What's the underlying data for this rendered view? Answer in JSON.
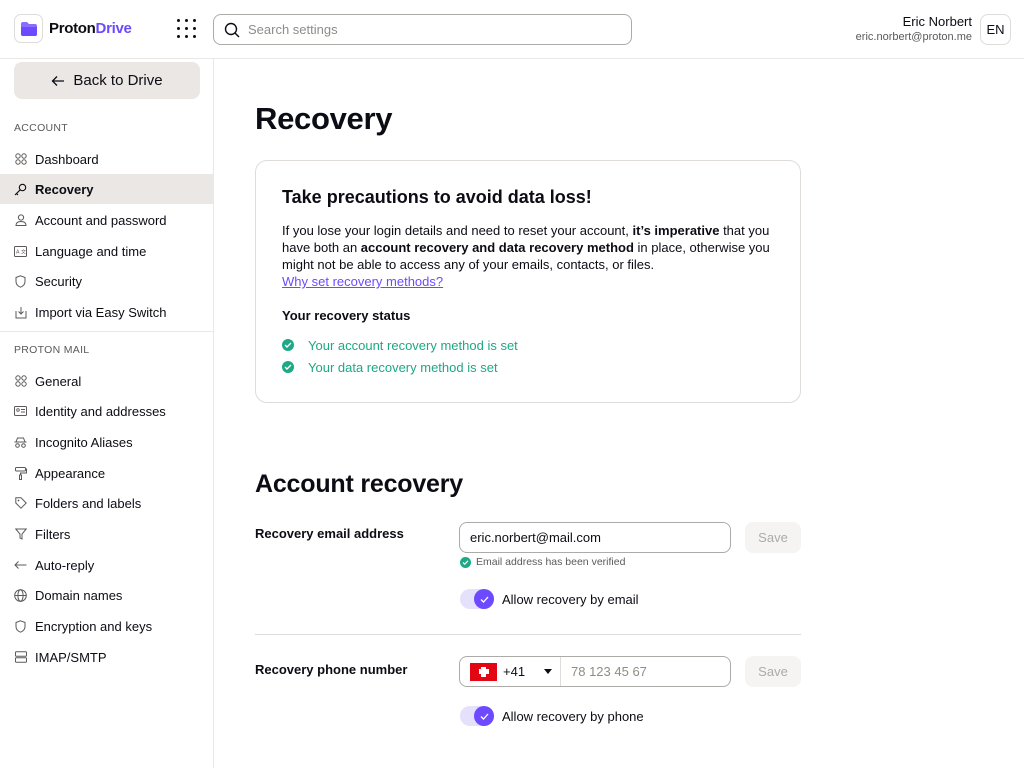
{
  "header": {
    "brand_first": "Proton",
    "brand_second": "Drive",
    "search_placeholder": "Search settings",
    "user_name": "Eric Norbert",
    "user_email": "eric.norbert@proton.me",
    "language": "EN"
  },
  "sidebar": {
    "back_label": "Back to Drive",
    "account_title": "ACCOUNT",
    "account_items": [
      {
        "label": "Dashboard",
        "icon": "grid-icon"
      },
      {
        "label": "Recovery",
        "icon": "key-icon",
        "active": true
      },
      {
        "label": "Account and password",
        "icon": "user-icon"
      },
      {
        "label": "Language and time",
        "icon": "language-icon"
      },
      {
        "label": "Security",
        "icon": "shield-icon"
      },
      {
        "label": "Import via Easy Switch",
        "icon": "import-icon"
      }
    ],
    "mail_title": "PROTON MAIL",
    "mail_items": [
      {
        "label": "General",
        "icon": "grid-icon"
      },
      {
        "label": "Identity and addresses",
        "icon": "id-card-icon"
      },
      {
        "label": "Incognito Aliases",
        "icon": "incognito-icon"
      },
      {
        "label": "Appearance",
        "icon": "paint-roller-icon"
      },
      {
        "label": "Folders and labels",
        "icon": "tag-icon"
      },
      {
        "label": "Filters",
        "icon": "filter-icon"
      },
      {
        "label": "Auto-reply",
        "icon": "reply-icon"
      },
      {
        "label": "Domain names",
        "icon": "globe-icon"
      },
      {
        "label": "Encryption and keys",
        "icon": "shield-icon"
      },
      {
        "label": "IMAP/SMTP",
        "icon": "servers-icon"
      }
    ]
  },
  "main": {
    "title": "Recovery",
    "card": {
      "title": "Take precautions to avoid data loss!",
      "text_1": "If you lose your login details and need to reset your account, ",
      "text_bold_1": "it’s imperative",
      "text_2": " that you have both an ",
      "text_bold_2": "account recovery and data recovery method",
      "text_3": " in place, otherwise you might not be able to access any of your emails, contacts, or files.",
      "link": "Why set recovery methods?",
      "status_title": "Your recovery status",
      "status_1": "Your account recovery method is set",
      "status_2": "Your data recovery method is set"
    },
    "account_recovery": {
      "heading": "Account recovery",
      "email_label": "Recovery email address",
      "email_value": "eric.norbert@mail.com",
      "save_label": "Save",
      "verified_text": "Email address has been verified",
      "allow_email_label": "Allow recovery by email",
      "allow_email_on": true,
      "phone_label": "Recovery phone number",
      "phone_code": "+41",
      "phone_placeholder": "78 123 45 67",
      "allow_phone_label": "Allow recovery by phone",
      "allow_phone_on": true
    }
  },
  "colors": {
    "accent": "#6d4aff",
    "success": "#1ea885",
    "active_bg": "#eae7e4"
  }
}
